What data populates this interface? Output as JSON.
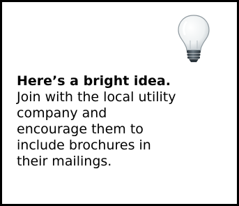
{
  "tip": {
    "heading": "Here’s a bright idea.",
    "body_lines": [
      "Join with the local utility",
      "company and",
      "encourage them to",
      "include brochures in",
      "their mailings."
    ]
  },
  "icon": {
    "name": "lightbulb-icon",
    "glass_color": "#f2f4f5",
    "base_color": "#44505a"
  }
}
